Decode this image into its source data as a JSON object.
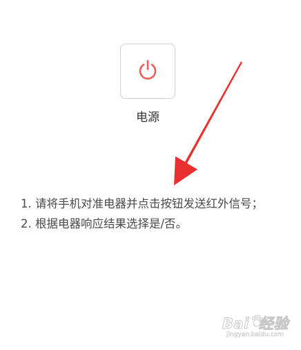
{
  "power_button": {
    "label": "电源",
    "icon": "power-icon",
    "icon_color": "#f05a5a",
    "border_color": "#cfcfcf"
  },
  "instructions": [
    "1. 请将手机对准电器并点击按钮发送红外信号；",
    "2. 根据电器响应结果选择是/否。"
  ],
  "annotation": {
    "arrow_color": "#e8312f"
  },
  "watermark": {
    "brand": "Bai du 经验",
    "url": "jingyan.baidu.com"
  }
}
